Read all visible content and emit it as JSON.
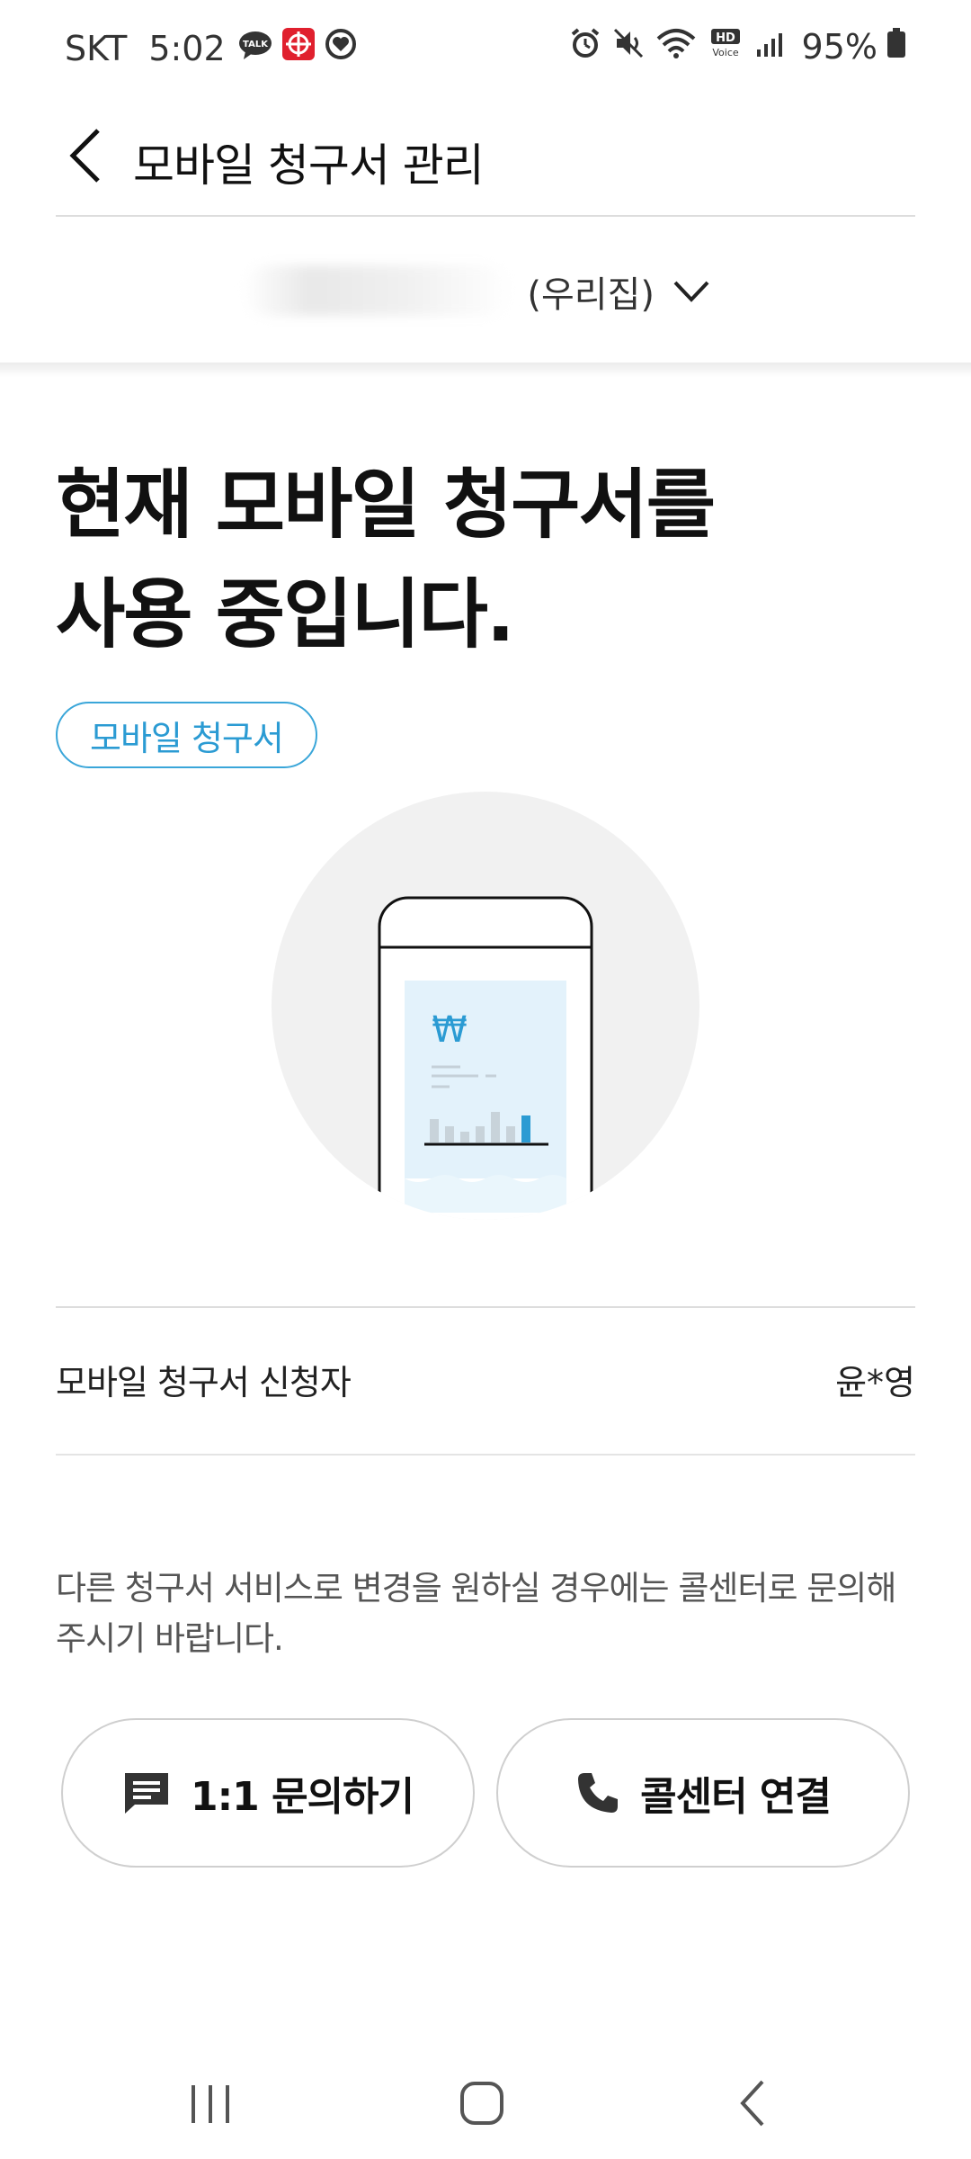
{
  "status_bar": {
    "carrier": "SKT",
    "time": "5:02",
    "battery": "95%"
  },
  "header": {
    "title": "모바일 청구서 관리"
  },
  "account": {
    "name_suffix": "(우리집)"
  },
  "headline": {
    "line1": "현재 모바일 청구서를",
    "line2": "사용 중입니다."
  },
  "chip": {
    "label": "모바일 청구서"
  },
  "illustration": {
    "currency_symbol": "₩"
  },
  "info": {
    "label": "모바일 청구서 신청자",
    "value": "윤*영"
  },
  "notice": {
    "text": "다른 청구서 서비스로 변경을 원하실 경우에는 콜센터로 문의해 주시기 바랍니다."
  },
  "buttons": {
    "inquiry": "1:1 문의하기",
    "call_center": "콜센터 연결"
  },
  "colors": {
    "accent": "#2b9bd3",
    "chip_border": "#3aa6d9"
  }
}
